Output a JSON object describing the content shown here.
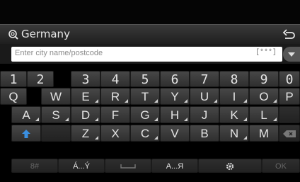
{
  "header": {
    "title": "Germany",
    "search_icon": "search-icon",
    "back_icon": "back-arrow-icon"
  },
  "search": {
    "placeholder": "Enter city name/postcode",
    "pattern": "[***]"
  },
  "keyboard": {
    "row1": [
      "1",
      "2",
      "3",
      "4",
      "5",
      "6",
      "7",
      "8",
      "9",
      "0"
    ],
    "row2": [
      "Q",
      "W",
      "E",
      "R",
      "T",
      "Y",
      "U",
      "I",
      "O",
      "P"
    ],
    "row3": [
      "A",
      "S",
      "D",
      "F",
      "G",
      "H",
      "J",
      "K",
      "L",
      ""
    ],
    "row4": [
      "",
      "",
      "Z",
      "X",
      "C",
      "V",
      "B",
      "N",
      "M",
      ""
    ],
    "row5": {
      "symbols": "8#",
      "latin": "Á...Ý",
      "space": "",
      "cyrillic": "A...Я",
      "settings": "",
      "ok": "OK"
    }
  },
  "colors": {
    "shift_arrow": "#3a8fe0",
    "key_bg": "#3a3a3a"
  }
}
